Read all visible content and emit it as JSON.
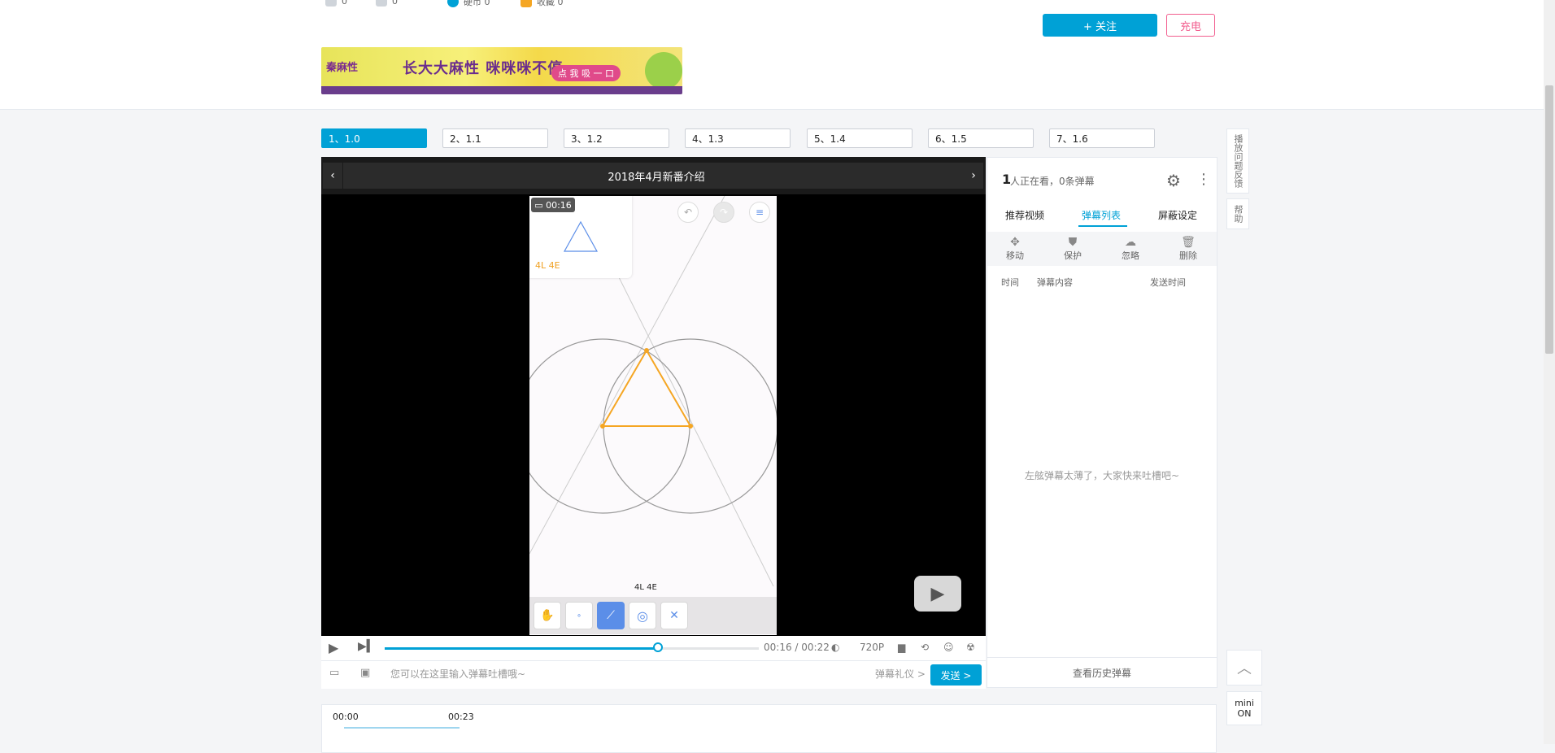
{
  "stats": {
    "likes": "0",
    "shares": "0",
    "coins_label": "硬币 0",
    "favorites_label": "收藏 0"
  },
  "up": {
    "follow_label": "+ 关注",
    "charge_label": "充电"
  },
  "banner": {
    "brand": "秦麻性",
    "slogan": "长大大麻性 咪咪咪不停",
    "cta": "点 我 吸 一 口"
  },
  "parts": [
    {
      "label": "1、1.0"
    },
    {
      "label": "2、1.1"
    },
    {
      "label": "3、1.2"
    },
    {
      "label": "4、1.3"
    },
    {
      "label": "5、1.4"
    },
    {
      "label": "6、1.5"
    },
    {
      "label": "7、1.6"
    }
  ],
  "player": {
    "title": "2018年4月新番介绍",
    "prev": "‹",
    "next": "›",
    "game_time": "00:16",
    "score_top": "4L 4E",
    "score_bottom": "4L  4E",
    "time_display": "00:16 / 00:22",
    "quality": "720P",
    "progress": 0.73,
    "danmu_placeholder": "您可以在这里输入弹幕吐槽哦~",
    "danmu_etiquette": "弹幕礼仪 >",
    "send_label": "发送 >"
  },
  "panel": {
    "viewers_count": "1",
    "viewers_text": "人正在看，0条弹幕",
    "tabs": [
      "推荐视频",
      "弹幕列表",
      "屏蔽设定"
    ],
    "actions": [
      {
        "icon": "✥",
        "label": "移动"
      },
      {
        "icon": "⛊",
        "label": "保护"
      },
      {
        "icon": "☁",
        "label": "忽略"
      },
      {
        "icon": "🗑",
        "label": "删除"
      }
    ],
    "columns": [
      "时间",
      "弹幕内容",
      "发送时间"
    ],
    "empty": "左舷弹幕太薄了，大家快来吐槽吧~",
    "history": "查看历史弹幕"
  },
  "rail": {
    "feedback": "播放问题反馈",
    "help": "帮助",
    "mini": "mini",
    "mini_state": "ON"
  },
  "timeline": {
    "start": "00:00",
    "end": "00:23"
  }
}
